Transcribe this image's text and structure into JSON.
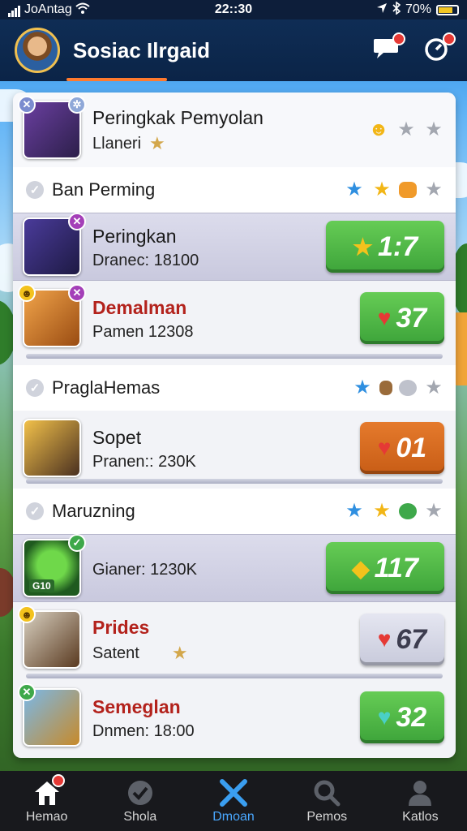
{
  "status_bar": {
    "carrier": "JoAntag",
    "time": "22::30",
    "battery": "70%"
  },
  "header": {
    "title": "Sosiac Ilrgaid"
  },
  "top_entry": {
    "title": "Peringkak Pemyolan",
    "subtitle": "Llaneri"
  },
  "sections": [
    {
      "title": "Ban Perming",
      "rows": [
        {
          "name": "Peringkan",
          "sub": "Dranec: 18100",
          "score": "1:7",
          "score_style": "green"
        },
        {
          "name": "Demalman",
          "sub": "Pamen 12308",
          "score": "37",
          "score_style": "green"
        }
      ]
    },
    {
      "title": "PraglaHemas",
      "rows": [
        {
          "name": "Sopet",
          "sub": "Pranen:: 230K",
          "score": "01",
          "score_style": "orange"
        }
      ]
    },
    {
      "title": "Maruzning",
      "rows": [
        {
          "name": "",
          "sub": "Gianer: 1230K",
          "score": "117",
          "score_style": "green"
        },
        {
          "name": "Prides",
          "sub": "Satent",
          "score": "67",
          "score_style": "gray"
        },
        {
          "name": "Semeglan",
          "sub": "Dnmen: 18:00",
          "score": "32",
          "score_style": "green"
        }
      ]
    }
  ],
  "avatar_badges": {
    "row3": "G10"
  },
  "bottom_nav": [
    {
      "label": "Hemao",
      "icon": "home-icon"
    },
    {
      "label": "Shola",
      "icon": "check-circle-icon"
    },
    {
      "label": "Dmoan",
      "icon": "crossed-swords-icon"
    },
    {
      "label": "Pemos",
      "icon": "search-icon"
    },
    {
      "label": "Katlos",
      "icon": "person-icon"
    }
  ],
  "colors": {
    "header_bg": "#0b2447",
    "accent_orange": "#ff7a2e",
    "score_green": "#3da43a",
    "score_orange": "#c85d16",
    "name_red": "#b3221c",
    "nav_active": "#4aa8ff"
  }
}
